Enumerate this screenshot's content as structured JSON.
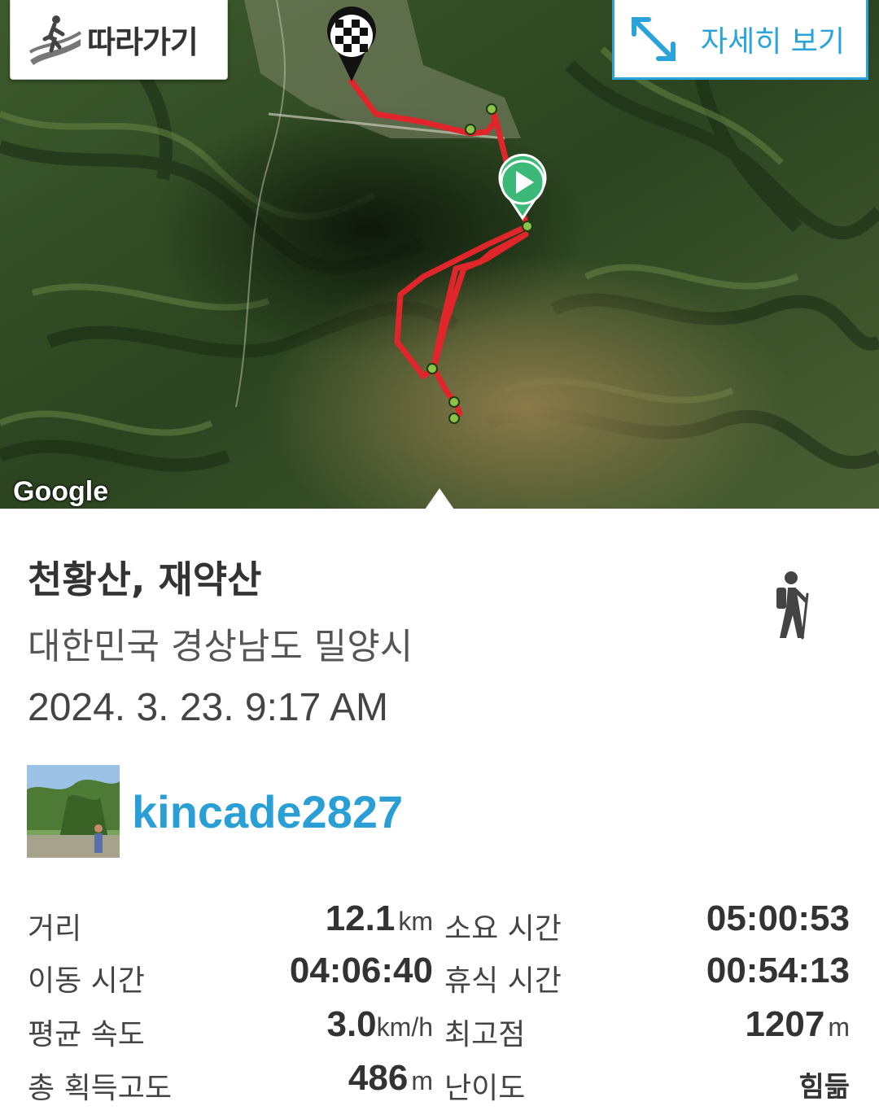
{
  "map": {
    "follow_label": "따라가기",
    "detail_label": "자세히 보기",
    "attribution": "Google",
    "colors": {
      "route": "#e0262a",
      "waypoint": "#8bc34a",
      "start_marker": "#3cb878"
    }
  },
  "trail": {
    "title": "천황산, 재약산",
    "location": "대한민국 경상남도 밀양시",
    "datetime": "2024. 3. 23. 9:17 AM",
    "activity_icon": "hiking-icon"
  },
  "user": {
    "name": "kincade2827"
  },
  "stats": {
    "distance": {
      "label": "거리",
      "value": "12.1",
      "unit": "km"
    },
    "total_time": {
      "label": "소요 시간",
      "value": "05:00:53"
    },
    "moving_time": {
      "label": "이동 시간",
      "value": "04:06:40"
    },
    "rest_time": {
      "label": "휴식 시간",
      "value": "00:54:13"
    },
    "avg_speed": {
      "label": "평균 속도",
      "value": "3.0",
      "unit": "km/h"
    },
    "max_elevation": {
      "label": "최고점",
      "value": "1207",
      "unit": "m"
    },
    "elevation_gain": {
      "label": "총 획득고도",
      "value": "486",
      "unit": "m"
    },
    "difficulty": {
      "label": "난이도",
      "value": "힘듦"
    }
  },
  "colors": {
    "accent": "#29a3d9",
    "text": "#333333"
  }
}
